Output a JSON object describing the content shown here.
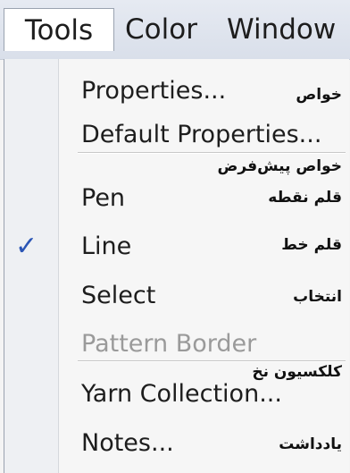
{
  "menubar": {
    "items": [
      {
        "label": "Tools"
      },
      {
        "label": "Color"
      },
      {
        "label": "Window"
      }
    ]
  },
  "menu": {
    "items": [
      {
        "label": "Properties...",
        "annotation": "خواص",
        "enabled": true
      },
      {
        "label": "Default Properties...",
        "annotation": "خواص پیش‌فرض",
        "enabled": true
      },
      {
        "label": "Pen",
        "annotation": "قلم نقطه",
        "enabled": true
      },
      {
        "label": "Line",
        "annotation": "قلم خط",
        "enabled": true,
        "checked": true
      },
      {
        "label": "Select",
        "annotation": "انتخاب",
        "enabled": true
      },
      {
        "label": "Pattern Border",
        "annotation": "",
        "enabled": false
      },
      {
        "label": "Yarn Collection...",
        "annotation": "کلکسیون نخ",
        "enabled": true
      },
      {
        "label": "Notes...",
        "annotation": "یادداشت",
        "enabled": true
      }
    ],
    "check_glyph": "✓",
    "check_color": "#2a55b5"
  }
}
